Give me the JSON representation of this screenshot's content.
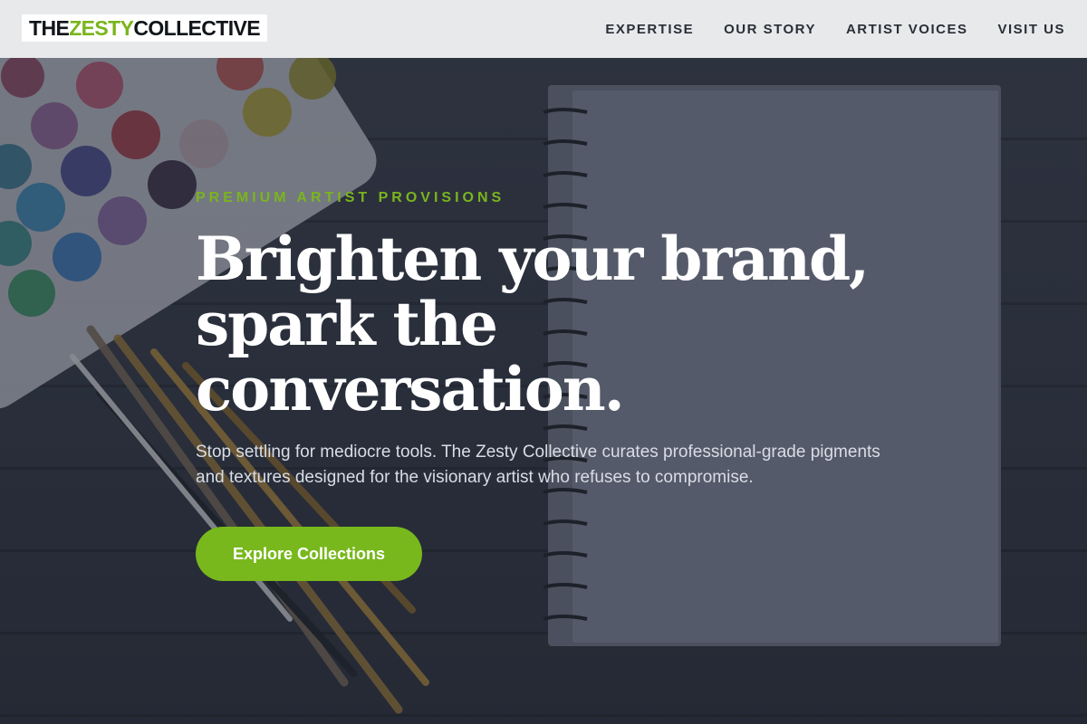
{
  "brand": {
    "part1": "THE ",
    "part2": "ZESTY",
    "part3": " COLLECTIVE"
  },
  "nav": [
    {
      "label": "EXPERTISE"
    },
    {
      "label": "OUR STORY"
    },
    {
      "label": "ARTIST VOICES"
    },
    {
      "label": "VISIT US"
    }
  ],
  "hero": {
    "eyebrow": "PREMIUM ARTIST PROVISIONS",
    "headline": "Brighten your brand, spark the conversation.",
    "lede": "Stop settling for mediocre tools. The Zesty Collective curates professional-grade pigments and textures designed for the visionary artist who refuses to compromise.",
    "cta": "Explore Collections"
  },
  "colors": {
    "accent": "#7ab51d",
    "header_bg": "#e8e9eb",
    "hero_overlay": "#1c212e"
  }
}
